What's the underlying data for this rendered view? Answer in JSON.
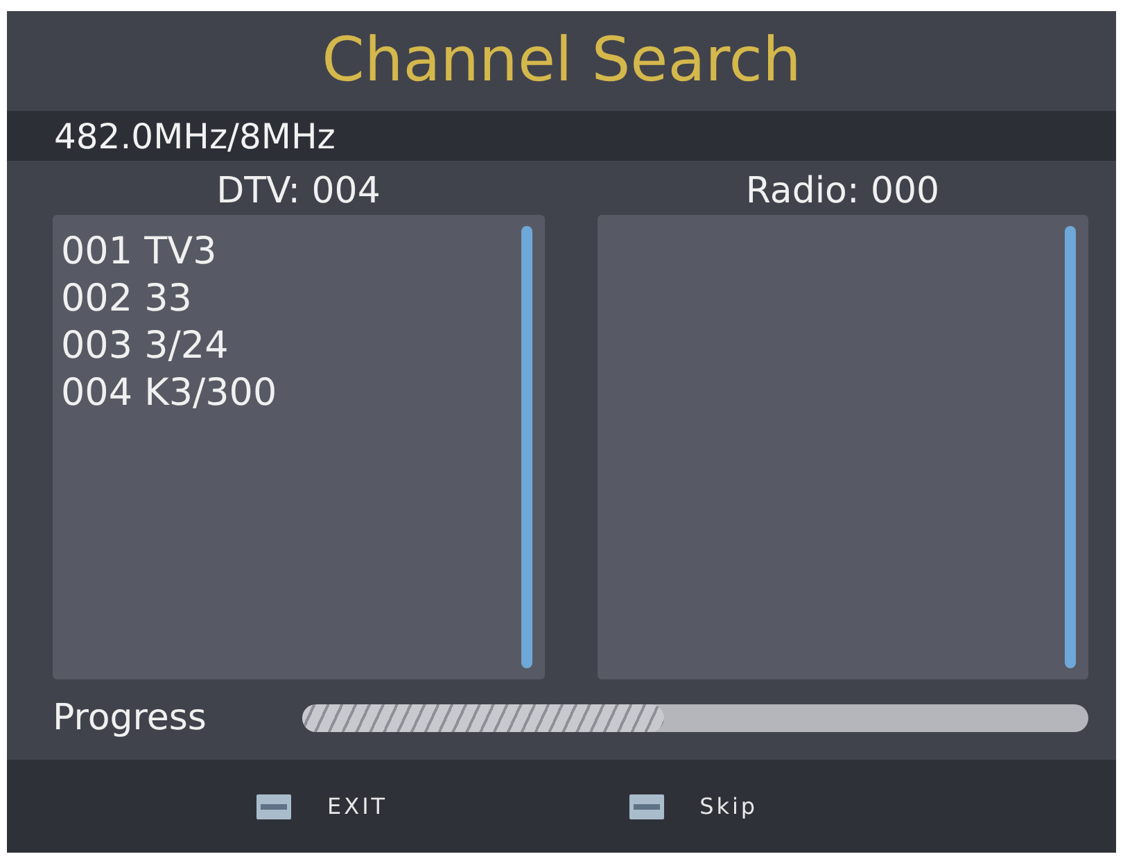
{
  "title": "Channel Search",
  "frequency": "482.0MHz/8MHz",
  "panels": [
    {
      "header": "DTV: 004",
      "channels": [
        "001 TV3",
        "002 33",
        "003 3/24",
        "004 K3/300"
      ]
    },
    {
      "header": "Radio: 000"
    }
  ],
  "progress": {
    "label": "Progress",
    "level": 0.46
  },
  "hints": [
    {
      "label": "EXIT"
    },
    {
      "label": "Skip"
    }
  ]
}
